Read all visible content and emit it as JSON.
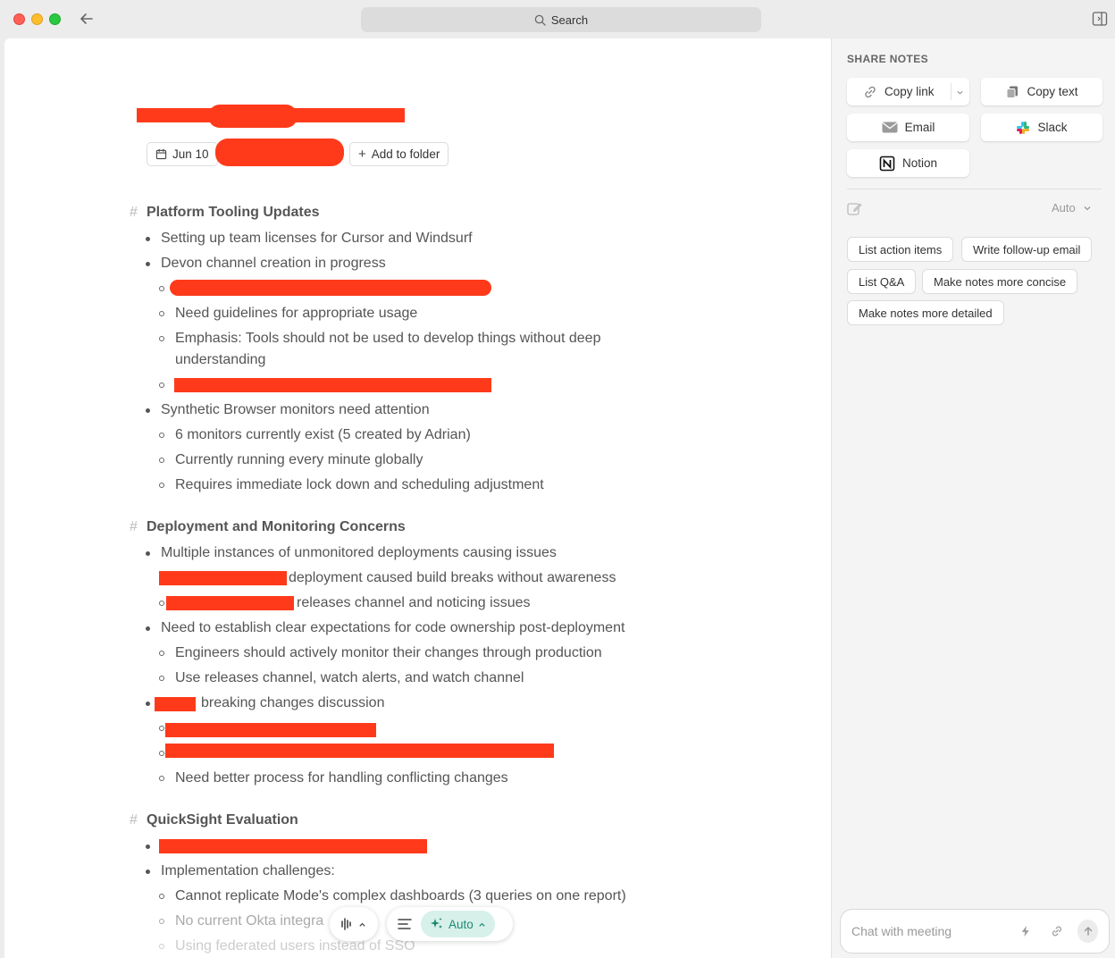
{
  "titlebar": {
    "search_label": "Search"
  },
  "document": {
    "date_chip": "Jun 10",
    "add_folder_chip": "Add to folder",
    "sections": [
      {
        "heading": "Platform Tooling Updates",
        "lines": [
          "Setting up team licenses for Cursor and Windsurf",
          "Devon channel creation in progress",
          "Need guidelines for appropriate usage",
          "Emphasis: Tools should not be used to develop things without deep",
          "understanding",
          "Synthetic Browser monitors need attention",
          "6 monitors currently exist (5 created by Adrian)",
          "Currently running every minute globally",
          "Requires immediate lock down and scheduling adjustment"
        ]
      },
      {
        "heading": "Deployment and Monitoring Concerns",
        "lines": [
          "Multiple instances of unmonitored deployments causing issues",
          "deployment caused build breaks without awareness",
          "releases channel and noticing issues",
          "Need to establish clear expectations for code ownership post-deployment",
          "Engineers should actively monitor their changes through production",
          "Use releases channel, watch alerts, and watch channel",
          "breaking changes discussion",
          "Need better process for handling conflicting changes"
        ]
      },
      {
        "heading": "QuickSight Evaluation",
        "lines": [
          "Implementation challenges:",
          "Cannot replicate Mode's complex dashboards (3 queries on one report)",
          "No current Okta integra",
          "Using federated users instead of SSO"
        ]
      }
    ]
  },
  "toolbar": {
    "auto_label": "Auto"
  },
  "panel": {
    "title": "SHARE NOTES",
    "copy_link": "Copy link",
    "copy_text": "Copy text",
    "email": "Email",
    "slack": "Slack",
    "notion": "Notion",
    "mode_label": "Auto",
    "quick_actions": [
      "List action items",
      "Write follow-up email",
      "List Q&A",
      "Make notes more concise",
      "Make notes more detailed"
    ],
    "chat_placeholder": "Chat with meeting"
  },
  "colors": {
    "redaction": "#ff3a1a",
    "accent": "#1e8a73",
    "accent_bg": "#d7f0ea"
  }
}
